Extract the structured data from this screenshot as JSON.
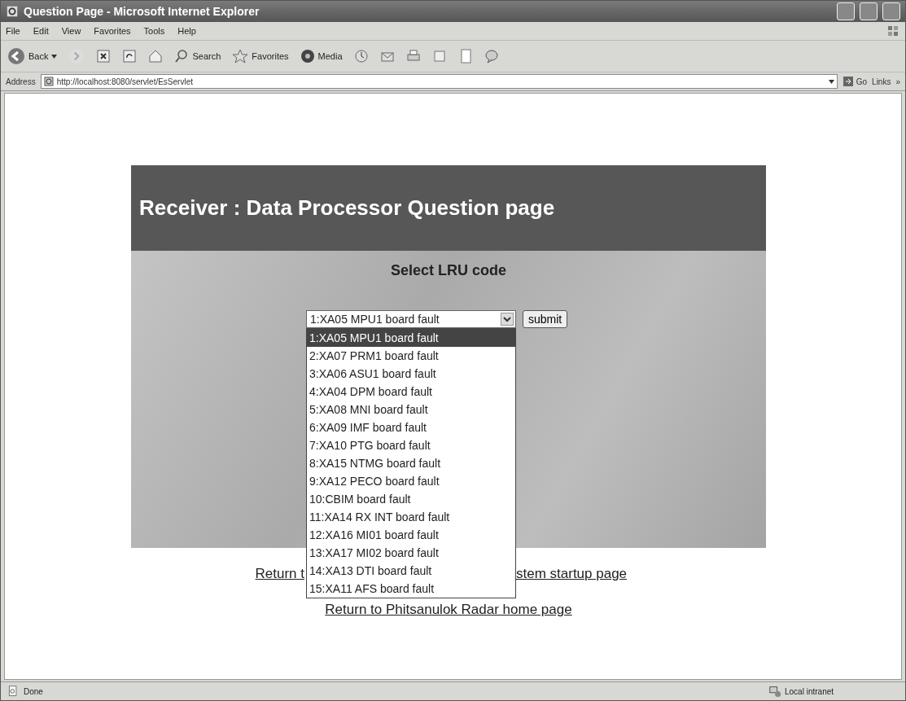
{
  "window": {
    "title": "Question Page - Microsoft Internet Explorer"
  },
  "menu": [
    "File",
    "Edit",
    "View",
    "Favorites",
    "Tools",
    "Help"
  ],
  "toolbar": {
    "back": "Back",
    "search": "Search",
    "favorites": "Favorites",
    "media": "Media"
  },
  "address": {
    "label": "Address",
    "url": "http://localhost:8080/servlet/EsServlet",
    "go": "Go",
    "links": "Links",
    "more": "»"
  },
  "page": {
    "heading": "Receiver : Data Processor Question page",
    "prompt": "Select LRU code",
    "select": {
      "value": "1:XA05 MPU1 board fault",
      "expanded": true
    },
    "options": [
      {
        "label": "1:XA05 MPU1 board fault",
        "selected": true
      },
      {
        "label": "2:XA07 PRM1 board fault",
        "selected": false
      },
      {
        "label": "3:XA06 ASU1 board fault",
        "selected": false
      },
      {
        "label": "4:XA04 DPM board fault",
        "selected": false
      },
      {
        "label": "5:XA08 MNI board fault",
        "selected": false
      },
      {
        "label": "6:XA09 IMF board fault",
        "selected": false
      },
      {
        "label": "7:XA10 PTG board fault",
        "selected": false
      },
      {
        "label": "8:XA15 NTMG board fault",
        "selected": false
      },
      {
        "label": "9:XA12 PECO board fault",
        "selected": false
      },
      {
        "label": "10:CBIM board fault",
        "selected": false
      },
      {
        "label": "11:XA14 RX INT board fault",
        "selected": false
      },
      {
        "label": "12:XA16 MI01 board fault",
        "selected": false
      },
      {
        "label": "13:XA17 MI02 board fault",
        "selected": false
      },
      {
        "label": "14:XA13 DTI board fault",
        "selected": false
      },
      {
        "label": "15:XA11 AFS board fault",
        "selected": false
      }
    ],
    "submit": "submit",
    "links": [
      {
        "kind": "split",
        "parts": [
          "Return t",
          "stem startup page"
        ]
      },
      {
        "kind": "whole",
        "parts": [
          "Return to Phitsanulok Radar home page"
        ]
      }
    ]
  },
  "status": {
    "text": "Done",
    "zone": "Local intranet"
  }
}
